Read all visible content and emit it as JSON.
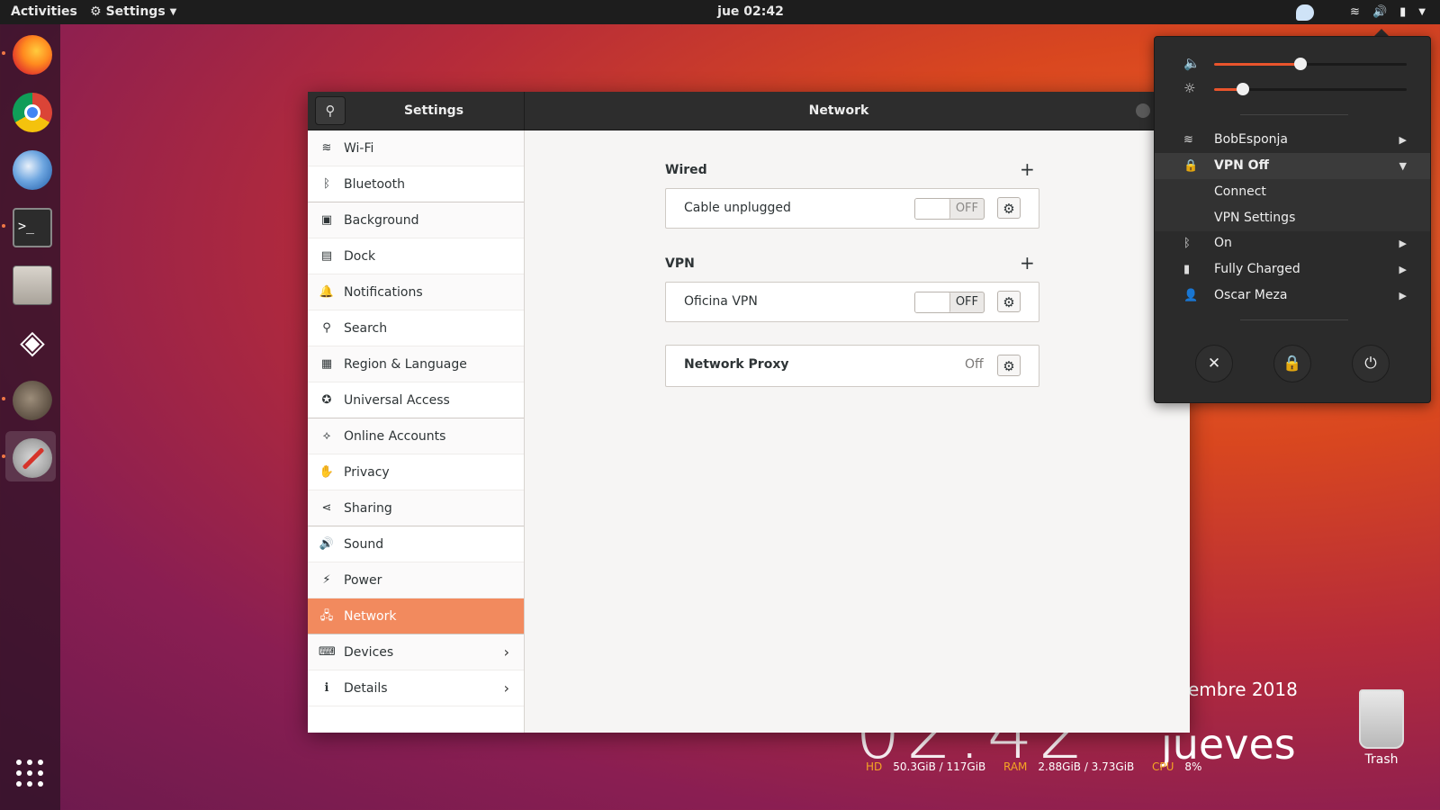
{
  "topbar": {
    "activities": "Activities",
    "app_menu": "Settings",
    "clock": "jue 02:42"
  },
  "window": {
    "left_title": "Settings",
    "title": "Network"
  },
  "sidebar": {
    "items": [
      {
        "label": "Wi-Fi",
        "icon": "wifi-icon",
        "glyph": "≋"
      },
      {
        "label": "Bluetooth",
        "icon": "bluetooth-icon",
        "glyph": "ᛒ"
      },
      {
        "label": "Background",
        "icon": "background-icon",
        "glyph": "▣"
      },
      {
        "label": "Dock",
        "icon": "dock-icon",
        "glyph": "▤"
      },
      {
        "label": "Notifications",
        "icon": "bell-icon",
        "glyph": "🔔"
      },
      {
        "label": "Search",
        "icon": "search-icon",
        "glyph": "⚲"
      },
      {
        "label": "Region & Language",
        "icon": "region-icon",
        "glyph": "▦"
      },
      {
        "label": "Universal Access",
        "icon": "accessibility-icon",
        "glyph": "✪"
      },
      {
        "label": "Online Accounts",
        "icon": "online-accounts-icon",
        "glyph": "⟡"
      },
      {
        "label": "Privacy",
        "icon": "privacy-hand-icon",
        "glyph": "✋"
      },
      {
        "label": "Sharing",
        "icon": "share-icon",
        "glyph": "⋖"
      },
      {
        "label": "Sound",
        "icon": "speaker-icon",
        "glyph": "🔊"
      },
      {
        "label": "Power",
        "icon": "power-battery-icon",
        "glyph": "⚡"
      },
      {
        "label": "Network",
        "icon": "network-icon",
        "glyph": "🖧"
      },
      {
        "label": "Devices",
        "icon": "devices-icon",
        "glyph": "⌨"
      },
      {
        "label": "Details",
        "icon": "details-icon",
        "glyph": "ℹ"
      }
    ]
  },
  "network": {
    "wired": {
      "title": "Wired",
      "add": "+",
      "connection": "Cable unplugged",
      "switch": "OFF"
    },
    "vpn": {
      "title": "VPN",
      "add": "+",
      "connection": "Oficina VPN",
      "switch": "OFF"
    },
    "proxy": {
      "label": "Network Proxy",
      "state": "Off"
    }
  },
  "desktop": {
    "clock": "02:42",
    "date": "embre 2018",
    "day": "jueves",
    "stats": {
      "hd_label": "HD",
      "hd_value": "50.3GiB / 117GiB",
      "ram_label": "RAM",
      "ram_value": "2.88GiB / 3.73GiB",
      "cpu_label": "CPU",
      "cpu_value": "8%"
    },
    "trash": "Trash"
  },
  "system_menu": {
    "volume_level": 0.45,
    "brightness_level": 0.15,
    "wifi": "BobEsponja",
    "vpn": "VPN Off",
    "vpn_connect": "Connect",
    "vpn_settings": "VPN Settings",
    "bluetooth": "On",
    "battery": "Fully Charged",
    "user": "Oscar Meza"
  },
  "colors": {
    "accent": "#f28a5e",
    "slider_fill": "#e9542c"
  }
}
